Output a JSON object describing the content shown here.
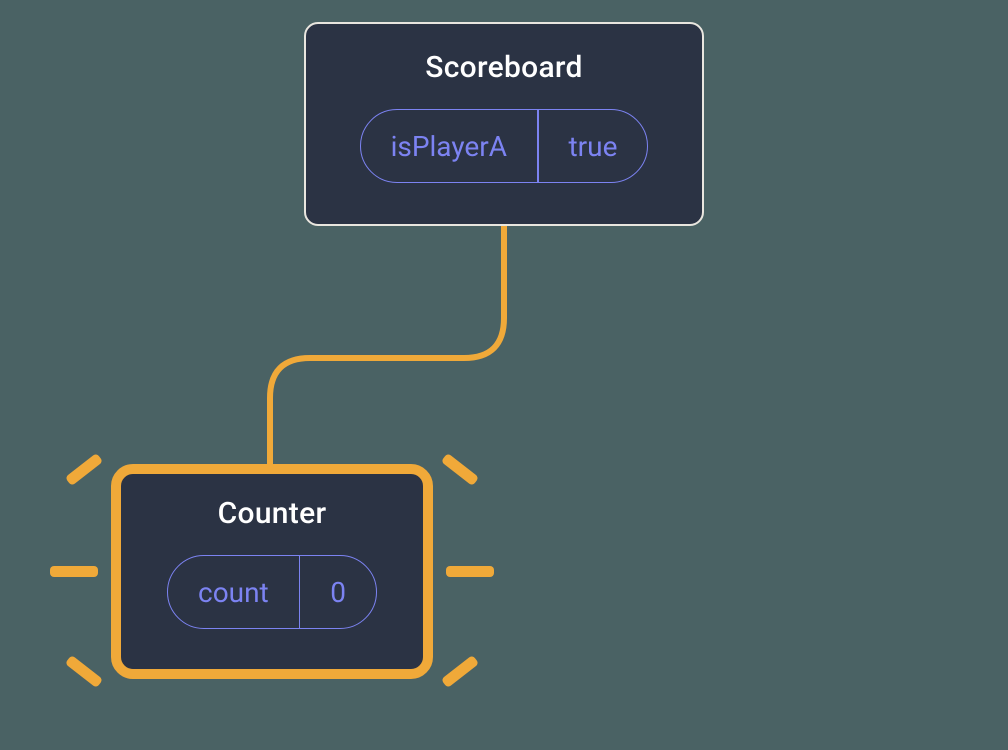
{
  "parent": {
    "title": "Scoreboard",
    "state_key": "isPlayerA",
    "state_value": "true"
  },
  "child": {
    "title": "Counter",
    "state_key": "count",
    "state_value": "0"
  },
  "colors": {
    "background": "#4a6264",
    "node_bg": "#2b3344",
    "node_border": "#e9e6df",
    "highlight": "#f0a939",
    "pill": "#7c83f2",
    "text": "#ffffff"
  }
}
